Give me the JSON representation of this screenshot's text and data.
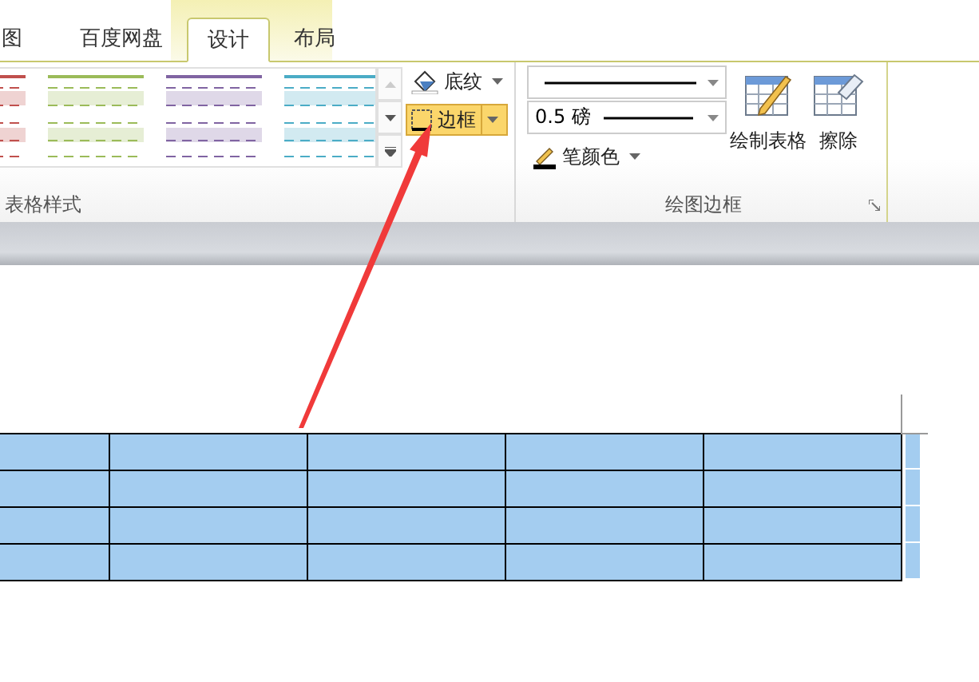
{
  "tabs": [
    {
      "label": "图",
      "selected": false
    },
    {
      "label": "百度网盘",
      "selected": false
    },
    {
      "label": "设计",
      "selected": true
    },
    {
      "label": "布局",
      "selected": false
    }
  ],
  "table_styles": {
    "label": "表格样式",
    "styles": [
      {
        "color": "#c0504d"
      },
      {
        "color": "#9bbb59"
      },
      {
        "color": "#8064a2"
      },
      {
        "color": "#4bacc6"
      }
    ]
  },
  "shading_button": {
    "label": "底纹"
  },
  "borders_button": {
    "label": "边框",
    "pressed": true
  },
  "draw_borders": {
    "label": "绘图边框",
    "line_weight": "0.5 磅",
    "pen_color": "笔颜色",
    "draw_table": "绘制表格",
    "eraser": "擦除"
  },
  "table": {
    "rows": [
      {
        "selected": true
      },
      {
        "selected": true
      },
      {
        "selected": true
      },
      {
        "selected": true
      }
    ]
  }
}
